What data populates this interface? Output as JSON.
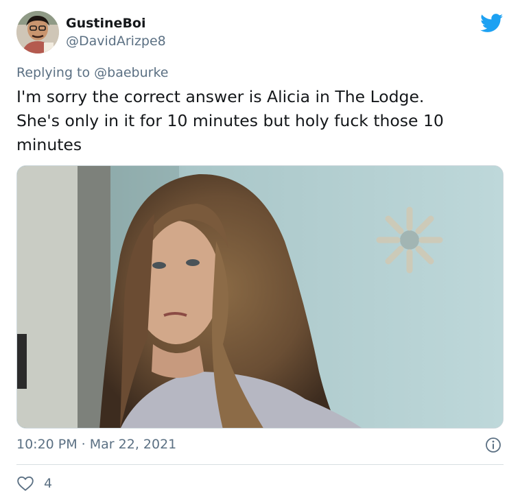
{
  "tweet": {
    "display_name": "GustineBoi",
    "handle": "@DavidArizpe8",
    "replying_to_prefix": "Replying to ",
    "replying_to_user": "@baeburke",
    "text_line1": "I'm sorry the correct answer is Alicia in The Lodge.",
    "text_line2": "She's only in it for 10 minutes but holy fuck those 10",
    "text_line3": "minutes",
    "timestamp": "10:20 PM · Mar 22, 2021",
    "like_count": "4"
  },
  "colors": {
    "twitter_blue": "#1da1f2",
    "secondary_text": "#5b7083",
    "primary_text": "#14171a"
  },
  "icons": {
    "logo": "twitter-bird-icon",
    "info": "info-icon",
    "like": "heart-outline-icon"
  }
}
